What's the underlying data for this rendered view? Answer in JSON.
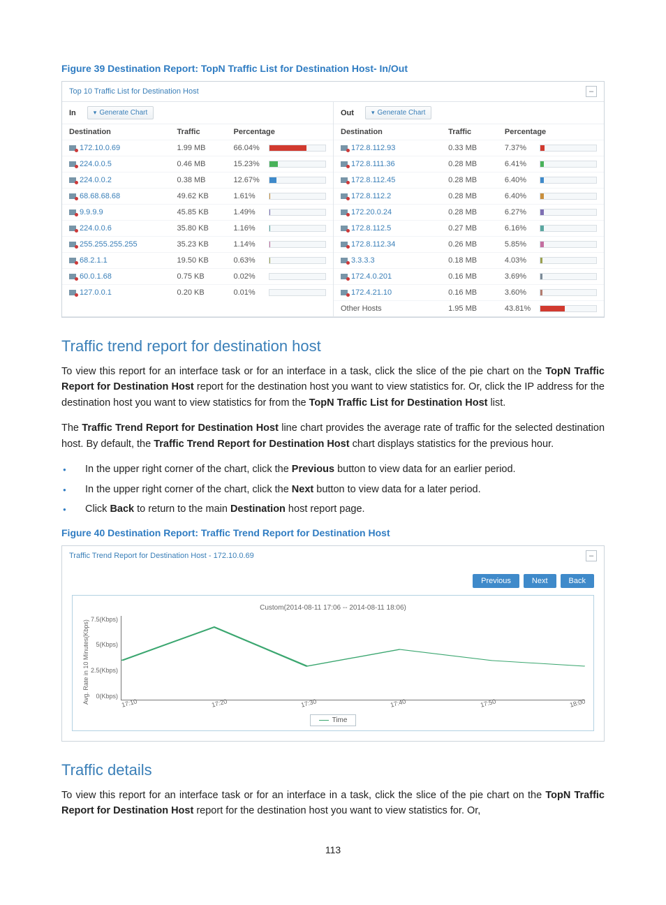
{
  "figure1": {
    "caption": "Figure 39 Destination Report: TopN Traffic List for Destination Host- In/Out",
    "panel_title": "Top 10 Traffic List for Destination Host",
    "in_label": "In",
    "out_label": "Out",
    "generate_chart": "Generate Chart",
    "headers": {
      "destination": "Destination",
      "traffic": "Traffic",
      "percentage": "Percentage"
    },
    "in_rows": [
      {
        "ip": "172.10.0.69",
        "traffic": "1.99 MB",
        "pct": "66.04%",
        "pctn": 66.04,
        "color": "#d13a2f"
      },
      {
        "ip": "224.0.0.5",
        "traffic": "0.46 MB",
        "pct": "15.23%",
        "pctn": 15.23,
        "color": "#49b25a"
      },
      {
        "ip": "224.0.0.2",
        "traffic": "0.38 MB",
        "pct": "12.67%",
        "pctn": 12.67,
        "color": "#3f8aca"
      },
      {
        "ip": "68.68.68.68",
        "traffic": "49.62 KB",
        "pct": "1.61%",
        "pctn": 1.61,
        "color": "#c98f3d"
      },
      {
        "ip": "9.9.9.9",
        "traffic": "45.85 KB",
        "pct": "1.49%",
        "pctn": 1.49,
        "color": "#7e6fb3"
      },
      {
        "ip": "224.0.0.6",
        "traffic": "35.80 KB",
        "pct": "1.16%",
        "pctn": 1.16,
        "color": "#5aa7a0"
      },
      {
        "ip": "255.255.255.255",
        "traffic": "35.23 KB",
        "pct": "1.14%",
        "pctn": 1.14,
        "color": "#c46fa0"
      },
      {
        "ip": "68.2.1.1",
        "traffic": "19.50 KB",
        "pct": "0.63%",
        "pctn": 0.63,
        "color": "#9aa04f"
      },
      {
        "ip": "60.0.1.68",
        "traffic": "0.75 KB",
        "pct": "0.02%",
        "pctn": 0.02,
        "color": "#7a8a97"
      },
      {
        "ip": "127.0.0.1",
        "traffic": "0.20 KB",
        "pct": "0.01%",
        "pctn": 0.01,
        "color": "#b37c6f"
      }
    ],
    "out_rows": [
      {
        "ip": "172.8.112.93",
        "traffic": "0.33 MB",
        "pct": "7.37%",
        "pctn": 7.37,
        "color": "#d13a2f"
      },
      {
        "ip": "172.8.111.36",
        "traffic": "0.28 MB",
        "pct": "6.41%",
        "pctn": 6.41,
        "color": "#49b25a"
      },
      {
        "ip": "172.8.112.45",
        "traffic": "0.28 MB",
        "pct": "6.40%",
        "pctn": 6.4,
        "color": "#3f8aca"
      },
      {
        "ip": "172.8.112.2",
        "traffic": "0.28 MB",
        "pct": "6.40%",
        "pctn": 6.4,
        "color": "#c98f3d"
      },
      {
        "ip": "172.20.0.24",
        "traffic": "0.28 MB",
        "pct": "6.27%",
        "pctn": 6.27,
        "color": "#7e6fb3"
      },
      {
        "ip": "172.8.112.5",
        "traffic": "0.27 MB",
        "pct": "6.16%",
        "pctn": 6.16,
        "color": "#5aa7a0"
      },
      {
        "ip": "172.8.112.34",
        "traffic": "0.26 MB",
        "pct": "5.85%",
        "pctn": 5.85,
        "color": "#c46fa0"
      },
      {
        "ip": "3.3.3.3",
        "traffic": "0.18 MB",
        "pct": "4.03%",
        "pctn": 4.03,
        "color": "#9aa04f"
      },
      {
        "ip": "172.4.0.201",
        "traffic": "0.16 MB",
        "pct": "3.69%",
        "pctn": 3.69,
        "color": "#7a8a97"
      },
      {
        "ip": "172.4.21.10",
        "traffic": "0.16 MB",
        "pct": "3.60%",
        "pctn": 3.6,
        "color": "#b37c6f"
      }
    ],
    "other_row": {
      "label": "Other Hosts",
      "traffic": "1.95 MB",
      "pct": "43.81%",
      "pctn": 43.81,
      "color": "#d13a2f"
    }
  },
  "section1": {
    "heading": "Traffic trend report for destination host",
    "p1": {
      "pre": "To view this report for an interface task or for an interface in a task, click the slice of the pie chart on the ",
      "b1": "TopN Traffic Report for Destination Host",
      "mid1": " report for the destination host you want to view statistics for. Or, click the IP address for the destination host you want to view statistics for from the ",
      "b2": "TopN Traffic List for Destination Host",
      "tail": " list."
    },
    "p2": {
      "pre": "The ",
      "b1": "Traffic Trend Report for Destination Host",
      "mid1": " line chart provides the average rate of traffic for the selected destination host. By default, the ",
      "b2": "Traffic Trend Report for Destination Host",
      "tail": " chart displays statistics for the previous hour."
    },
    "b1": {
      "pre": "In the upper right corner of the chart, click the ",
      "b": "Previous",
      "tail": " button to view data for an earlier period."
    },
    "b2": {
      "pre": "In the upper right corner of the chart, click the ",
      "b": "Next",
      "tail": " button to view data for a later period."
    },
    "b3": {
      "pre": "Click ",
      "b": "Back",
      "mid": " to return to the main ",
      "b2": "Destination",
      "tail": " host report page."
    }
  },
  "figure2": {
    "caption": "Figure 40 Destination Report: Traffic Trend Report for Destination Host",
    "panel_title": "Traffic Trend Report for Destination Host - 172.10.0.69",
    "buttons": {
      "prev": "Previous",
      "next": "Next",
      "back": "Back"
    },
    "chart_subtitle": "Custom(2014-08-11 17:06 -- 2014-08-11 18:06)",
    "ylabel": "Avg. Rate in 10 Minutes(Kbps)",
    "legend": "Time"
  },
  "chart_data": {
    "type": "line",
    "title": "Traffic Trend Report for Destination Host - 172.10.0.69",
    "subtitle": "Custom(2014-08-11 17:06 -- 2014-08-11 18:06)",
    "xlabel": "Time",
    "ylabel": "Avg. Rate in 10 Minutes(Kbps)",
    "ylim": [
      0,
      7.5
    ],
    "yticks": [
      "7.5(Kbps)",
      "5(Kbps)",
      "2.5(Kbps)",
      "0(Kbps)"
    ],
    "xticks": [
      "17:10",
      "17:20",
      "17:30",
      "17:40",
      "17:50",
      "18:00"
    ],
    "series": [
      {
        "name": "Time",
        "color": "#3aa66f",
        "x": [
          "17:10",
          "17:20",
          "17:30",
          "17:40",
          "17:50",
          "18:00"
        ],
        "values": [
          3.5,
          6.5,
          3.0,
          4.5,
          3.5,
          3.0
        ]
      }
    ]
  },
  "section2": {
    "heading": "Traffic details",
    "p1": {
      "pre": "To view this report for an interface task or for an interface in a task, click the slice of the pie chart on the ",
      "b1": "TopN Traffic Report for Destination Host",
      "tail": " report for the destination host you want to view statistics for. Or,"
    }
  },
  "pagenum": "113"
}
